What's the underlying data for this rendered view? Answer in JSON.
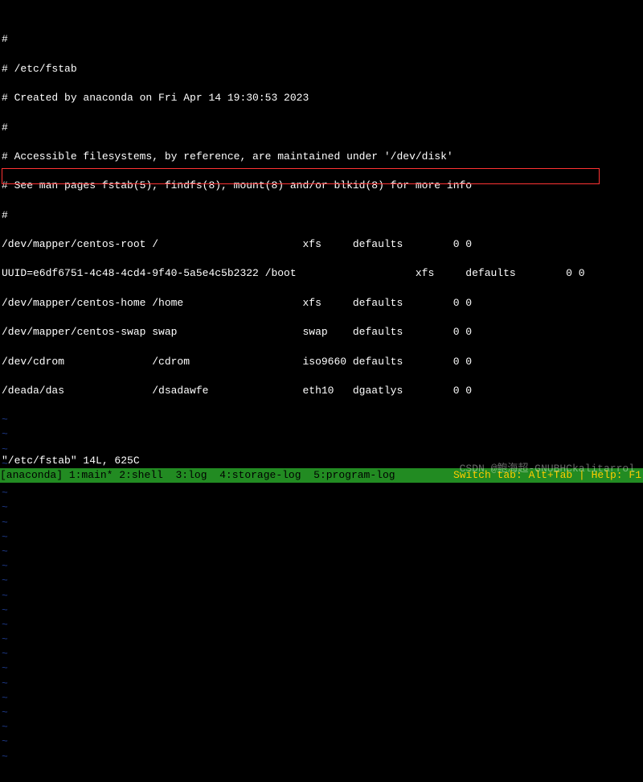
{
  "fstab": {
    "lines": [
      "",
      "#",
      "# /etc/fstab",
      "# Created by anaconda on Fri Apr 14 19:30:53 2023",
      "#",
      "# Accessible filesystems, by reference, are maintained under '/dev/disk'",
      "# See man pages fstab(5), findfs(8), mount(8) and/or blkid(8) for more info",
      "#",
      "/dev/mapper/centos-root /                       xfs     defaults        0 0",
      "UUID=e6df6751-4c48-4cd4-9f40-5a5e4c5b2322 /boot                   xfs     defaults        0 0",
      "/dev/mapper/centos-home /home                   xfs     defaults        0 0",
      "/dev/mapper/centos-swap swap                    swap    defaults        0 0",
      "/dev/cdrom              /cdrom                  iso9660 defaults        0 0",
      "/deada/das              /dsadawfe               eth10   dgaatlys        0 0"
    ]
  },
  "tildes": "~\n~\n~\n~\n~\n~\n~\n~\n~\n~\n~\n~\n~\n~\n~\n~\n~\n~\n~\n~\n~\n~\n~\n~",
  "vim_status": "\"/etc/fstab\" 14L, 625C",
  "tmux": {
    "session": "[anaconda]",
    "windows": [
      "1:main*",
      "2:shell ",
      "3:log ",
      "4:storage-log ",
      "5:program-log "
    ],
    "right": "Switch tab: Alt+Tab | Help: F1"
  },
  "watermark": "CSDN @鲍海超-GNUBHCkalitarrol"
}
